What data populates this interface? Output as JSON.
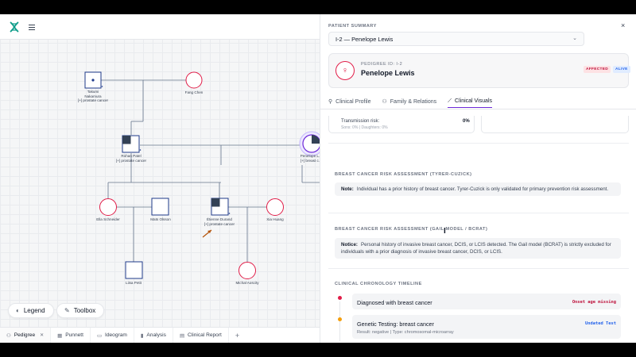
{
  "app": {
    "logo": "dna-logo-icon",
    "menu": "hamburger-icon"
  },
  "pedigree": {
    "nodes": [
      {
        "id": "takumi",
        "shape": "square",
        "label1": "Takumi",
        "label2": "Nakamura",
        "label3": "[+] prostate cancer"
      },
      {
        "id": "fang",
        "shape": "circle",
        "label1": "Fang Chen"
      },
      {
        "id": "rohan",
        "shape": "square",
        "label1": "Rohan Patel",
        "label2": "[+] prostate cancer"
      },
      {
        "id": "penelope",
        "shape": "circle",
        "label1": "Penelope L.",
        "label2": "[+] breast c."
      },
      {
        "id": "ella",
        "shape": "circle",
        "label1": "Ella Schneider"
      },
      {
        "id": "mats",
        "shape": "square",
        "label1": "Mats Olsson"
      },
      {
        "id": "etienne",
        "shape": "square",
        "label1": "Étienne Durand",
        "label2": "[+] prostate cancer"
      },
      {
        "id": "xia",
        "shape": "circle",
        "label1": "Xia Huang"
      },
      {
        "id": "liisa",
        "shape": "square",
        "label1": "Liisa Petit"
      },
      {
        "id": "michal",
        "shape": "circle",
        "label1": "Michał Aoscity"
      }
    ]
  },
  "controls": {
    "legend_label": "Legend",
    "toolbox_label": "Toolbox"
  },
  "bottom_tabs": [
    {
      "label": "Pedigree",
      "icon": "people-icon",
      "active": true,
      "closable": true
    },
    {
      "label": "Punnett",
      "icon": "grid-icon"
    },
    {
      "label": "Ideogram",
      "icon": "chromosome-icon"
    },
    {
      "label": "Analysis",
      "icon": "chart-icon"
    },
    {
      "label": "Clinical Report",
      "icon": "document-icon"
    }
  ],
  "add_tab": "+",
  "panel": {
    "section_title": "Patient Summary",
    "selected_patient": "I-2 — Penelope Lewis",
    "close": "×",
    "pedigree_id": "PEDIGREE ID: I-2",
    "patient_name": "Penelope Lewis",
    "badges": {
      "affected": "AFFECTED",
      "alive": "ALIVE"
    },
    "tabs": [
      {
        "label": "Clinical Profile",
        "icon": "person-icon"
      },
      {
        "label": "Family & Relations",
        "icon": "family-icon"
      },
      {
        "label": "Clinical Visuals",
        "icon": "chart-icon",
        "active": true
      }
    ],
    "transmission": {
      "label": "Transmission risk:",
      "value": "0%",
      "sub": "Sons: 0% | Daughters: 0%"
    },
    "tyrer": {
      "title": "Breast Cancer Risk Assessment (Tyrer-Cuzick)",
      "note_label": "Note:",
      "note_text": "Individual has a prior history of breast cancer. Tyrer-Cuzick is only validated for primary prevention risk assessment."
    },
    "gail": {
      "title": "Breast Cancer Risk Assessment (Gail Model / BCRAT)",
      "note_label": "Notice:",
      "note_text": "Personal history of invasive breast cancer, DCIS, or LCIS detected. The Gail model (BCRAT) is strictly excluded for individuals with a prior diagnosis of invasive breast cancer, DCIS, or LCIS."
    },
    "timeline": {
      "title": "Clinical Chronology Timeline",
      "items": [
        {
          "title": "Diagnosed with breast cancer",
          "tag": "Onset age missing",
          "color": "#e11d48"
        },
        {
          "title": "Genetic Testing: breast cancer",
          "tag": "Undated Test",
          "sub": "Result: negative | Type: chromosomal-microarray",
          "color": "#f59e0b"
        }
      ]
    }
  },
  "colors": {
    "accent": "#6d28d9",
    "affected": "#e11d48",
    "male": "#1e3a8a",
    "female": "#e11d48"
  }
}
